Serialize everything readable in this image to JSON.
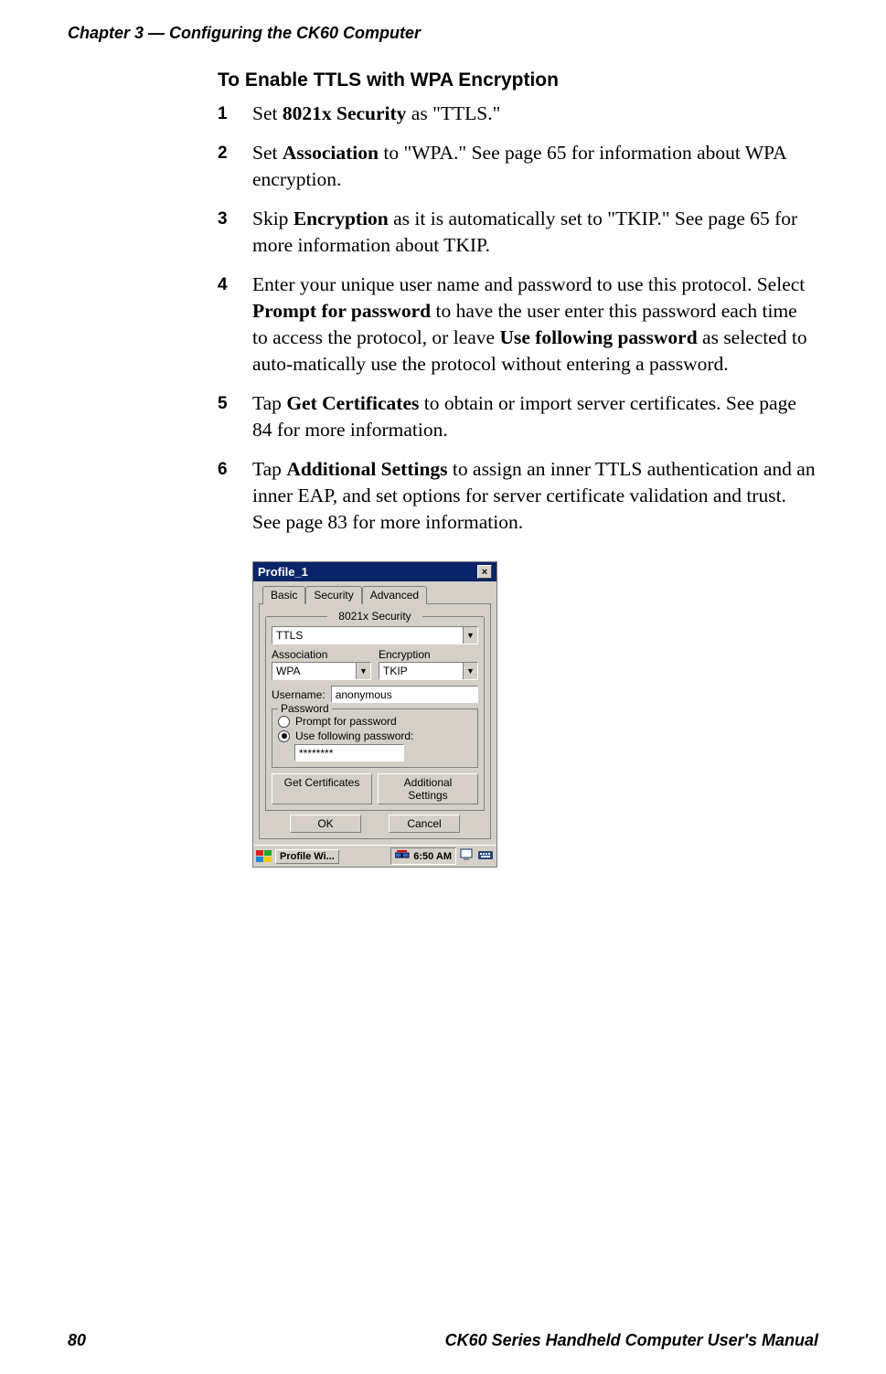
{
  "header": {
    "chapter_line": "Chapter 3 — Configuring the CK60 Computer"
  },
  "section": {
    "title": "To Enable TTLS with WPA Encryption"
  },
  "steps": {
    "s1_num": "1",
    "s1_pre": "Set ",
    "s1_bold": "8021x Security",
    "s1_post": " as \"TTLS.\"",
    "s2_num": "2",
    "s2_pre": "Set ",
    "s2_bold": "Association",
    "s2_post": " to \"WPA.\" See page 65 for information about WPA encryption.",
    "s3_num": "3",
    "s3_pre": "Skip ",
    "s3_bold": "Encryption",
    "s3_post": " as it is automatically set to \"TKIP.\" See page 65 for more information about TKIP.",
    "s4_num": "4",
    "s4_pre": "Enter your unique user name and password to use this protocol. Select ",
    "s4_bold1": "Prompt for password",
    "s4_mid": " to have the user enter this password each time to access the protocol, or leave ",
    "s4_bold2": "Use following password",
    "s4_post": " as selected to auto-matically use the protocol without entering a password.",
    "s5_num": "5",
    "s5_pre": "Tap ",
    "s5_bold": "Get Certificates",
    "s5_post": " to obtain or import server certificates. See page 84 for more information.",
    "s6_num": "6",
    "s6_pre": "Tap ",
    "s6_bold": "Additional Settings",
    "s6_post": " to assign an inner TTLS authentication and an inner EAP, and set options for server certificate validation and trust. See page 83 for more information."
  },
  "dialog": {
    "title": "Profile_1",
    "close": "×",
    "tabs": {
      "basic": "Basic",
      "security": "Security",
      "advanced": "Advanced"
    },
    "sec_group": "8021x Security",
    "sec_value": "TTLS",
    "assoc_label": "Association",
    "assoc_value": "WPA",
    "enc_label": "Encryption",
    "enc_value": "TKIP",
    "username_label": "Username:",
    "username_value": "anonymous",
    "password_legend": "Password",
    "radio_prompt": "Prompt for password",
    "radio_usefollowing": "Use following password:",
    "password_value": "********",
    "get_certs": "Get Certificates",
    "additional": "Additional Settings",
    "ok": "OK",
    "cancel": "Cancel"
  },
  "taskbar": {
    "app": "Profile Wi...",
    "time": "6:50 AM"
  },
  "footer": {
    "page": "80",
    "manual": "CK60 Series Handheld Computer User's Manual"
  }
}
